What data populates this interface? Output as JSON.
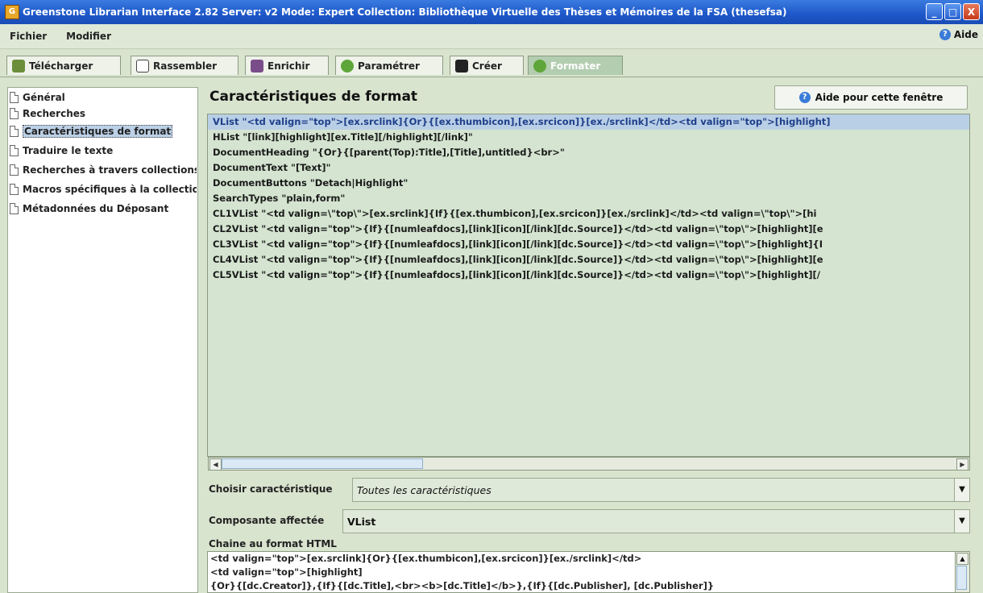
{
  "window": {
    "title": "Greenstone Librarian Interface 2.82  Server: v2  Mode: Expert  Collection: Bibliothèque Virtuelle des Thèses et Mémoires de la FSA (thesefsa)",
    "minimize": "_",
    "maximize": "□",
    "close": "X"
  },
  "menu": {
    "fichier": "Fichier",
    "modifier": "Modifier",
    "aide": "Aide"
  },
  "tabs": [
    {
      "label": "Télécharger",
      "icon": "download-icon"
    },
    {
      "label": "Rassembler",
      "icon": "gather-icon"
    },
    {
      "label": "Enrichir",
      "icon": "enrich-icon"
    },
    {
      "label": "Paramétrer",
      "icon": "gear-icon"
    },
    {
      "label": "Créer",
      "icon": "create-icon"
    },
    {
      "label": "Formater",
      "icon": "gear-icon",
      "active": true
    }
  ],
  "sidebar": {
    "items": [
      {
        "label": "Général"
      },
      {
        "label": "Recherches"
      },
      {
        "label": "Caractéristiques de format",
        "selected": true
      },
      {
        "label": "Traduire le texte"
      },
      {
        "label": "Recherches à travers collections"
      },
      {
        "label": "Macros spécifiques à la collection"
      },
      {
        "label": "Métadonnées du Déposant"
      }
    ]
  },
  "main": {
    "title": "Caractéristiques de format",
    "help_button": "Aide pour cette fenêtre",
    "format_list": [
      "VList \"<td valign=\"top\">[ex.srclink]{Or}{[ex.thumbicon],[ex.srcicon]}[ex./srclink]</td><td valign=\"top\">[highlight]",
      "HList \"[link][highlight][ex.Title][/highlight][/link]\"",
      "DocumentHeading \"{Or}{[parent(Top):Title],[Title],untitled}<br>\"",
      "DocumentText \"[Text]\"",
      "DocumentButtons \"Detach|Highlight\"",
      "SearchTypes \"plain,form\"",
      "CL1VList \"<td valign=\\\"top\\\">[ex.srclink]{If}{[ex.thumbicon],[ex.srcicon]}[ex./srclink]</td><td valign=\\\"top\\\">[hi",
      "CL2VList \"<td valign=\"top\">{If}{[numleafdocs],[link][icon][/link][dc.Source]}</td><td valign=\\\"top\\\">[highlight][e",
      "CL3VList \"<td valign=\"top\">{If}{[numleafdocs],[link][icon][/link][dc.Source]}</td><td valign=\\\"top\\\">[highlight]{I",
      "CL4VList \"<td valign=\"top\">{If}{[numleafdocs],[link][icon][/link][dc.Source]}</td><td valign=\\\"top\\\">[highlight][e",
      "CL5VList \"<td valign=\"top\">{If}{[numleafdocs],[link][icon][/link][dc.Source]}</td><td valign=\\\"top\\\">[highlight][/"
    ],
    "choose_label": "Choisir caractéristique",
    "choose_value": "Toutes les caractéristiques",
    "component_label": "Composante affectée",
    "component_value": "VList",
    "html_label": "Chaine au format HTML",
    "html_lines": [
      "<td valign=\"top\">[ex.srclink]{Or}{[ex.thumbicon],[ex.srcicon]}[ex./srclink]</td>",
      "<td valign=\"top\">[highlight]",
      "{Or}{[dc.Creator]},{If}{[dc.Title],<br><b>[dc.Title]</b>},{If}{[dc.Publisher],  [dc.Publisher]}"
    ]
  },
  "colors": {
    "titlebar": "#1d57c9",
    "panel_bg": "#d9e4cf",
    "list_bg": "#d4e4d0",
    "selection": "#b9cfe6"
  }
}
